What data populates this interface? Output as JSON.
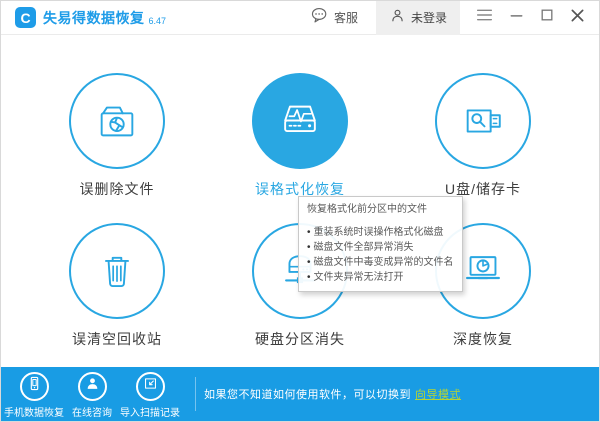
{
  "titlebar": {
    "logo_glyph": "C",
    "app_title": "失易得数据恢复",
    "version": "6.47",
    "support_label": "客服",
    "login_label": "未登录"
  },
  "features": [
    {
      "label": "误删除文件",
      "icon": "folder-broken-file-icon",
      "active": false
    },
    {
      "label": "误格式化恢复",
      "icon": "formatted-drive-pulse-icon",
      "active": true
    },
    {
      "label": "U盘/储存卡",
      "icon": "usb-search-icon",
      "active": false
    },
    {
      "label": "误清空回收站",
      "icon": "trash-icon",
      "active": false
    },
    {
      "label": "硬盘分区消失",
      "icon": "disk-partition-icon",
      "active": false
    },
    {
      "label": "深度恢复",
      "icon": "laptop-clock-icon",
      "active": false
    }
  ],
  "tooltip": {
    "title": "恢复格式化前分区中的文件",
    "items": [
      "重装系统时误操作格式化磁盘",
      "磁盘文件全部异常消失",
      "磁盘文件中毒变成异常的文件名",
      "文件夹异常无法打开"
    ]
  },
  "footer": {
    "buttons": [
      {
        "label": "手机数据恢复",
        "icon": "phone-icon"
      },
      {
        "label": "在线咨询",
        "icon": "person-icon"
      },
      {
        "label": "导入扫描记录",
        "icon": "import-record-icon"
      }
    ],
    "hint": "如果您不知道如何使用软件，可以切换到",
    "link": "向导模式"
  },
  "colors": {
    "accent_blue": "#29a7e2",
    "title_blue": "#1e9ce8",
    "footer_bg": "#199ce4",
    "link_green": "#b5d434"
  }
}
